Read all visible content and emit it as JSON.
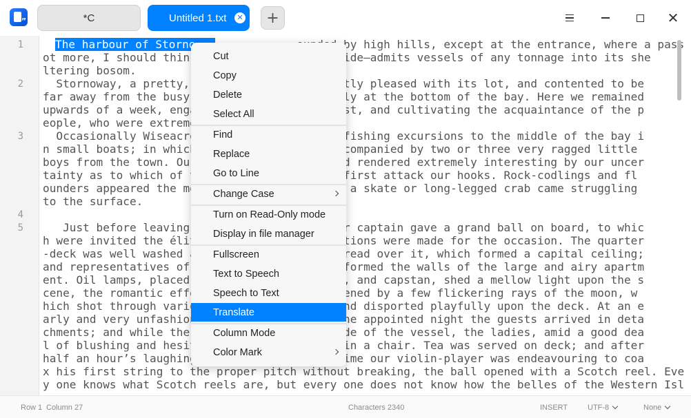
{
  "tabs": [
    {
      "label": "*C"
    },
    {
      "label": "Untitled 1.txt",
      "active": true
    }
  ],
  "icons": {
    "app": "text-editor-icon",
    "tab_close": "close-icon",
    "add_tab": "plus-icon",
    "menu": "hamburger-menu-icon",
    "minimize": "minimize-icon",
    "maximize": "maximize-icon",
    "close": "close-icon"
  },
  "colors": {
    "accent": "#0081ff",
    "text": "#545454",
    "selection_text": "#ffffff"
  },
  "gutter": {
    "line_numbers": [
      "1",
      "2",
      "3",
      "4",
      "5"
    ]
  },
  "editor": {
    "selected_text": "The harbour of Storno",
    "lines": [
      "  The harbour of Storno               ounded by high hills, except at the entrance, where a passage—n",
      "ot more, I should think               yards wide—admits vessels of any tonnage into its she",
      "ltering bosom.",
      "  Stornoway, a pretty,                 pparently pleased with its lot, and contented to be",
      "far away from the busy                 s snugly at the bottom of the bay. Here we remained",
      "upwards of a week, enga                or’-West, and cultivating the acquaintance of the p",
      "eople, who were extreme                able.",
      "  Occasionally Wiseacre                 with fishing excursions to the middle of the bay i",
      "n small boats; in which               ally accompanied by two or three very ragged little",
      "boys from the town. Our                od, and rendered extremely interesting by our uncer",
      "tainty as to which of t                would first attack our hooks. Rock-codlings and fl",
      "ounders appeared the mo               ionally a skate or long-legged crab came struggling",
      "to the surface.",
      "",
      "   Just before leaving                 ot, our captain gave a grand ball on board, to whic",
      "h were invited the élit                reparations were made for the occasion. The quarter",
      "-deck was well washed a                was spread over it, which formed a capital ceiling;",
      "and representatives of                 waves formed the walls of the large and airy apartm",
      "ent. Oil lamps, placed                 panion, and capstan, shed a mellow light upon the s",
      "cene, the romantic effe                heightened by a few flickering rays of the moon, w",
      "hich shot through vario                ery, and disported playfully upon the deck. At an e",
      "arly and very unfashion                g of the appointed night the guests arrived in deta",
      "chments; and while the                 the side of the vessel, the ladies, amid a good dea",
      "l of blushing and hesit                board in a chair. Tea was served on deck; and after",
      "half an hour’s laughing                hich time our violin-player was endeavouring to coa",
      "x his first string to the proper pitch without breaking, the ball opened with a Scotch reel. Ever",
      "y one knows what Scotch reels are, but every one does not know how the belles of the Western Isle"
    ]
  },
  "context_menu": {
    "items": [
      {
        "label": "Cut"
      },
      {
        "label": "Copy"
      },
      {
        "label": "Delete"
      },
      {
        "label": "Select All"
      },
      {
        "label": "Find"
      },
      {
        "label": "Replace"
      },
      {
        "label": "Go to Line"
      },
      {
        "label": "Change Case",
        "submenu": true
      },
      {
        "label": "Turn on Read-Only mode"
      },
      {
        "label": "Display in file manager"
      },
      {
        "label": "Fullscreen"
      },
      {
        "label": "Text to Speech"
      },
      {
        "label": "Speech to Text"
      },
      {
        "label": "Translate",
        "highlighted": true
      },
      {
        "label": "Column Mode"
      },
      {
        "label": "Color Mark",
        "submenu": true
      }
    ]
  },
  "statusbar": {
    "row": "Row 1",
    "column": "Column 27",
    "characters": "Characters 2340",
    "mode": "INSERT",
    "encoding": "UTF-8",
    "highlight": "None"
  }
}
